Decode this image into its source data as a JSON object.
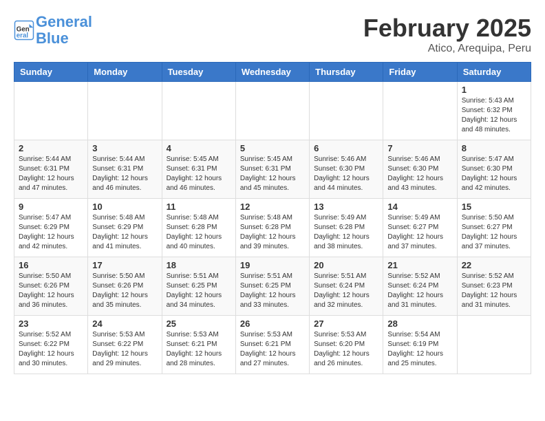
{
  "header": {
    "logo_line1": "General",
    "logo_line2": "Blue",
    "month": "February 2025",
    "location": "Atico, Arequipa, Peru"
  },
  "days_of_week": [
    "Sunday",
    "Monday",
    "Tuesday",
    "Wednesday",
    "Thursday",
    "Friday",
    "Saturday"
  ],
  "weeks": [
    [
      {
        "day": "",
        "info": ""
      },
      {
        "day": "",
        "info": ""
      },
      {
        "day": "",
        "info": ""
      },
      {
        "day": "",
        "info": ""
      },
      {
        "day": "",
        "info": ""
      },
      {
        "day": "",
        "info": ""
      },
      {
        "day": "1",
        "info": "Sunrise: 5:43 AM\nSunset: 6:32 PM\nDaylight: 12 hours\nand 48 minutes."
      }
    ],
    [
      {
        "day": "2",
        "info": "Sunrise: 5:44 AM\nSunset: 6:31 PM\nDaylight: 12 hours\nand 47 minutes."
      },
      {
        "day": "3",
        "info": "Sunrise: 5:44 AM\nSunset: 6:31 PM\nDaylight: 12 hours\nand 46 minutes."
      },
      {
        "day": "4",
        "info": "Sunrise: 5:45 AM\nSunset: 6:31 PM\nDaylight: 12 hours\nand 46 minutes."
      },
      {
        "day": "5",
        "info": "Sunrise: 5:45 AM\nSunset: 6:31 PM\nDaylight: 12 hours\nand 45 minutes."
      },
      {
        "day": "6",
        "info": "Sunrise: 5:46 AM\nSunset: 6:30 PM\nDaylight: 12 hours\nand 44 minutes."
      },
      {
        "day": "7",
        "info": "Sunrise: 5:46 AM\nSunset: 6:30 PM\nDaylight: 12 hours\nand 43 minutes."
      },
      {
        "day": "8",
        "info": "Sunrise: 5:47 AM\nSunset: 6:30 PM\nDaylight: 12 hours\nand 42 minutes."
      }
    ],
    [
      {
        "day": "9",
        "info": "Sunrise: 5:47 AM\nSunset: 6:29 PM\nDaylight: 12 hours\nand 42 minutes."
      },
      {
        "day": "10",
        "info": "Sunrise: 5:48 AM\nSunset: 6:29 PM\nDaylight: 12 hours\nand 41 minutes."
      },
      {
        "day": "11",
        "info": "Sunrise: 5:48 AM\nSunset: 6:28 PM\nDaylight: 12 hours\nand 40 minutes."
      },
      {
        "day": "12",
        "info": "Sunrise: 5:48 AM\nSunset: 6:28 PM\nDaylight: 12 hours\nand 39 minutes."
      },
      {
        "day": "13",
        "info": "Sunrise: 5:49 AM\nSunset: 6:28 PM\nDaylight: 12 hours\nand 38 minutes."
      },
      {
        "day": "14",
        "info": "Sunrise: 5:49 AM\nSunset: 6:27 PM\nDaylight: 12 hours\nand 37 minutes."
      },
      {
        "day": "15",
        "info": "Sunrise: 5:50 AM\nSunset: 6:27 PM\nDaylight: 12 hours\nand 37 minutes."
      }
    ],
    [
      {
        "day": "16",
        "info": "Sunrise: 5:50 AM\nSunset: 6:26 PM\nDaylight: 12 hours\nand 36 minutes."
      },
      {
        "day": "17",
        "info": "Sunrise: 5:50 AM\nSunset: 6:26 PM\nDaylight: 12 hours\nand 35 minutes."
      },
      {
        "day": "18",
        "info": "Sunrise: 5:51 AM\nSunset: 6:25 PM\nDaylight: 12 hours\nand 34 minutes."
      },
      {
        "day": "19",
        "info": "Sunrise: 5:51 AM\nSunset: 6:25 PM\nDaylight: 12 hours\nand 33 minutes."
      },
      {
        "day": "20",
        "info": "Sunrise: 5:51 AM\nSunset: 6:24 PM\nDaylight: 12 hours\nand 32 minutes."
      },
      {
        "day": "21",
        "info": "Sunrise: 5:52 AM\nSunset: 6:24 PM\nDaylight: 12 hours\nand 31 minutes."
      },
      {
        "day": "22",
        "info": "Sunrise: 5:52 AM\nSunset: 6:23 PM\nDaylight: 12 hours\nand 31 minutes."
      }
    ],
    [
      {
        "day": "23",
        "info": "Sunrise: 5:52 AM\nSunset: 6:22 PM\nDaylight: 12 hours\nand 30 minutes."
      },
      {
        "day": "24",
        "info": "Sunrise: 5:53 AM\nSunset: 6:22 PM\nDaylight: 12 hours\nand 29 minutes."
      },
      {
        "day": "25",
        "info": "Sunrise: 5:53 AM\nSunset: 6:21 PM\nDaylight: 12 hours\nand 28 minutes."
      },
      {
        "day": "26",
        "info": "Sunrise: 5:53 AM\nSunset: 6:21 PM\nDaylight: 12 hours\nand 27 minutes."
      },
      {
        "day": "27",
        "info": "Sunrise: 5:53 AM\nSunset: 6:20 PM\nDaylight: 12 hours\nand 26 minutes."
      },
      {
        "day": "28",
        "info": "Sunrise: 5:54 AM\nSunset: 6:19 PM\nDaylight: 12 hours\nand 25 minutes."
      },
      {
        "day": "",
        "info": ""
      }
    ]
  ]
}
